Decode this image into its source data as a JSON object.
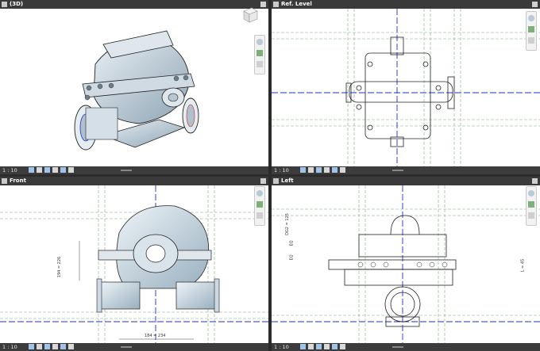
{
  "panes": {
    "p3d": {
      "title": "(3D)",
      "scale": "1 : 10"
    },
    "ref": {
      "title": "Ref. Level",
      "scale": "1 : 10"
    },
    "front": {
      "title": "Front",
      "scale": "1 : 10",
      "dim_v": "194 = 226",
      "dim_h": "184 = 234"
    },
    "left": {
      "title": "Left",
      "scale": "1 : 10",
      "dim_a": "DG2 = 125",
      "dim_b": "EQ",
      "dim_c": "EQ",
      "dim_d": "L = 45"
    }
  },
  "colors": {
    "grid_green": "#7fae7f",
    "ref_blue": "#1d2fd6",
    "titlebar": "#3a3a3a",
    "pump_metal": "#c8d6e0"
  },
  "icons": [
    "window-icon",
    "close-icon",
    "viewcube-icon",
    "navigation-wheel-icon",
    "zoom-icon",
    "detail-level-icon",
    "visual-style-icon"
  ]
}
